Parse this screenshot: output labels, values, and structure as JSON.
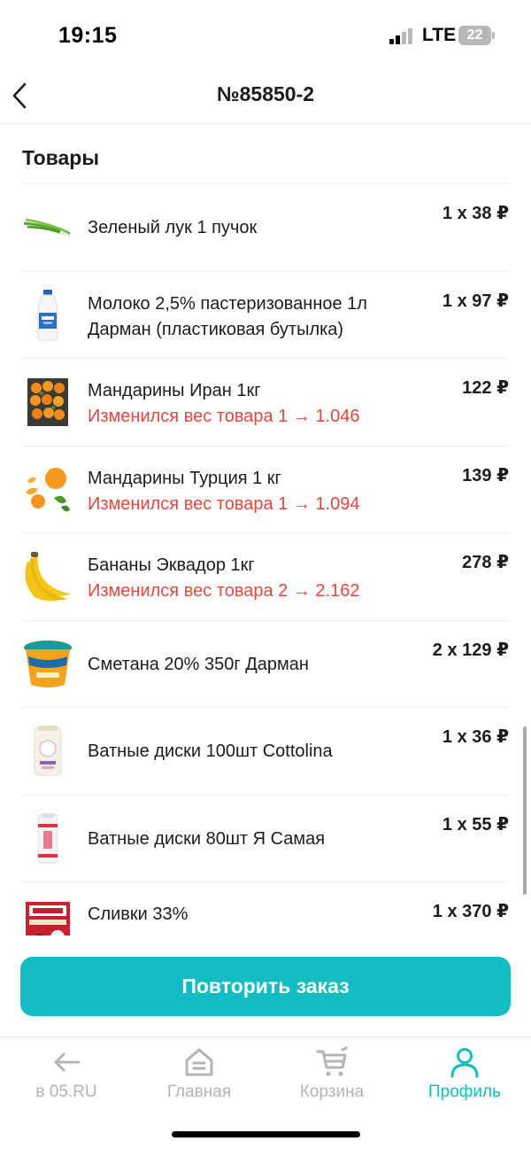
{
  "status_bar": {
    "time": "19:15",
    "network": "LTE",
    "battery": "22"
  },
  "header": {
    "title": "№85850-2",
    "back_icon": "chevron-left-icon"
  },
  "section": {
    "title": "Товары"
  },
  "items": [
    {
      "name": "Зеленый лук 1 пучок",
      "note": "",
      "price": "1 x 38 ₽",
      "icon": "green-onion-icon"
    },
    {
      "name": "Молоко 2,5% пастеризованное 1л Дарман (пластиковая бутылка)",
      "note": "",
      "price": "1 x 97 ₽",
      "icon": "milk-bottle-icon"
    },
    {
      "name": "Мандарины Иран 1кг",
      "note": "Изменился вес товара 1 → 1.046",
      "price": "122 ₽",
      "icon": "mandarin-box-icon"
    },
    {
      "name": "Мандарины Турция 1 кг",
      "note": "Изменился вес товара 1 → 1.094",
      "price": "139 ₽",
      "icon": "mandarin-icon"
    },
    {
      "name": "Бананы Эквадор 1кг",
      "note": "Изменился вес товара 2 → 2.162",
      "price": "278 ₽",
      "icon": "banana-icon"
    },
    {
      "name": "Сметана 20% 350г Дарман",
      "note": "",
      "price": "2 x 129 ₽",
      "icon": "sour-cream-cup-icon"
    },
    {
      "name": "Ватные диски 100шт Cottolina",
      "note": "",
      "price": "1 x 36 ₽",
      "icon": "cotton-pads-pack-icon"
    },
    {
      "name": "Ватные диски 80шт Я Самая",
      "note": "",
      "price": "1 x 55 ₽",
      "icon": "cotton-pads-pack-icon"
    },
    {
      "name": "Сливки 33%",
      "note": "",
      "price": "1 x 370 ₽",
      "icon": "cream-carton-icon"
    }
  ],
  "repeat_button": {
    "label": "Повторить заказ"
  },
  "tabbar": {
    "tabs": [
      {
        "label": "в 05.RU",
        "icon": "arrow-left-icon",
        "active": false
      },
      {
        "label": "Главная",
        "icon": "home-icon",
        "active": false
      },
      {
        "label": "Корзина",
        "icon": "cart-icon",
        "active": false
      },
      {
        "label": "Профиль",
        "icon": "profile-icon",
        "active": true
      }
    ]
  },
  "colors": {
    "accent": "#12bcc3",
    "warning": "#e5483f",
    "inactive": "#b4b4b8",
    "text": "#1c1c1e"
  }
}
